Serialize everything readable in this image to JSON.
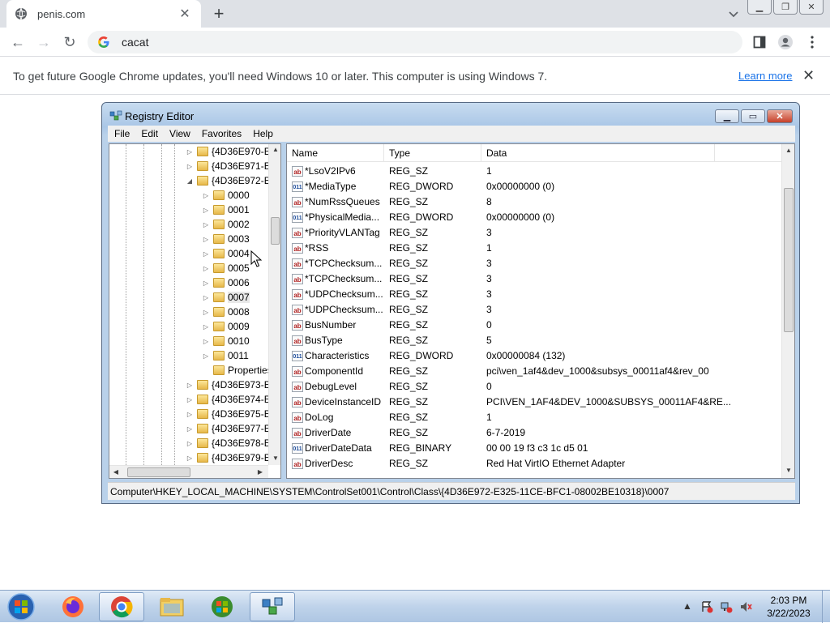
{
  "browser": {
    "tab_title": "penis.com",
    "tab_close": "✕",
    "new_tab": "+",
    "omnibox_text": "cacat",
    "infobar_text": "To get future Google Chrome updates, you'll need Windows 10 or later. This computer is using Windows 7.",
    "infobar_link": "Learn more",
    "infobar_close": "✕"
  },
  "regedit": {
    "title": "Registry Editor",
    "menu": [
      "File",
      "Edit",
      "View",
      "Favorites",
      "Help"
    ],
    "tree": [
      {
        "label": "{4D36E970-E",
        "expander": "▷",
        "indent": 0
      },
      {
        "label": "{4D36E971-E",
        "expander": "▷",
        "indent": 0
      },
      {
        "label": "{4D36E972-E",
        "expander": "◢",
        "indent": 0
      },
      {
        "label": "0000",
        "expander": "▷",
        "indent": 1
      },
      {
        "label": "0001",
        "expander": "▷",
        "indent": 1
      },
      {
        "label": "0002",
        "expander": "▷",
        "indent": 1
      },
      {
        "label": "0003",
        "expander": "▷",
        "indent": 1
      },
      {
        "label": "0004",
        "expander": "▷",
        "indent": 1
      },
      {
        "label": "0005",
        "expander": "▷",
        "indent": 1
      },
      {
        "label": "0006",
        "expander": "▷",
        "indent": 1
      },
      {
        "label": "0007",
        "expander": "▷",
        "indent": 1,
        "selected": true
      },
      {
        "label": "0008",
        "expander": "▷",
        "indent": 1
      },
      {
        "label": "0009",
        "expander": "▷",
        "indent": 1
      },
      {
        "label": "0010",
        "expander": "▷",
        "indent": 1
      },
      {
        "label": "0011",
        "expander": "▷",
        "indent": 1
      },
      {
        "label": "Properties",
        "expander": "",
        "indent": 1
      },
      {
        "label": "{4D36E973-E",
        "expander": "▷",
        "indent": 0
      },
      {
        "label": "{4D36E974-E",
        "expander": "▷",
        "indent": 0
      },
      {
        "label": "{4D36E975-E",
        "expander": "▷",
        "indent": 0
      },
      {
        "label": "{4D36E977-E",
        "expander": "▷",
        "indent": 0
      },
      {
        "label": "{4D36E978-E",
        "expander": "▷",
        "indent": 0
      },
      {
        "label": "{4D36E979-E",
        "expander": "▷",
        "indent": 0
      }
    ],
    "columns": {
      "name": "Name",
      "type": "Type",
      "data": "Data"
    },
    "values": [
      {
        "icon": "ab",
        "name": "*LsoV2IPv6",
        "type": "REG_SZ",
        "data": "1"
      },
      {
        "icon": "bin",
        "name": "*MediaType",
        "type": "REG_DWORD",
        "data": "0x00000000 (0)"
      },
      {
        "icon": "ab",
        "name": "*NumRssQueues",
        "type": "REG_SZ",
        "data": "8"
      },
      {
        "icon": "bin",
        "name": "*PhysicalMedia...",
        "type": "REG_DWORD",
        "data": "0x00000000 (0)"
      },
      {
        "icon": "ab",
        "name": "*PriorityVLANTag",
        "type": "REG_SZ",
        "data": "3"
      },
      {
        "icon": "ab",
        "name": "*RSS",
        "type": "REG_SZ",
        "data": "1"
      },
      {
        "icon": "ab",
        "name": "*TCPChecksum...",
        "type": "REG_SZ",
        "data": "3"
      },
      {
        "icon": "ab",
        "name": "*TCPChecksum...",
        "type": "REG_SZ",
        "data": "3"
      },
      {
        "icon": "ab",
        "name": "*UDPChecksum...",
        "type": "REG_SZ",
        "data": "3"
      },
      {
        "icon": "ab",
        "name": "*UDPChecksum...",
        "type": "REG_SZ",
        "data": "3"
      },
      {
        "icon": "ab",
        "name": "BusNumber",
        "type": "REG_SZ",
        "data": "0"
      },
      {
        "icon": "ab",
        "name": "BusType",
        "type": "REG_SZ",
        "data": "5"
      },
      {
        "icon": "bin",
        "name": "Characteristics",
        "type": "REG_DWORD",
        "data": "0x00000084 (132)"
      },
      {
        "icon": "ab",
        "name": "ComponentId",
        "type": "REG_SZ",
        "data": "pci\\ven_1af4&dev_1000&subsys_00011af4&rev_00"
      },
      {
        "icon": "ab",
        "name": "DebugLevel",
        "type": "REG_SZ",
        "data": "0"
      },
      {
        "icon": "ab",
        "name": "DeviceInstanceID",
        "type": "REG_SZ",
        "data": "PCI\\VEN_1AF4&DEV_1000&SUBSYS_00011AF4&RE..."
      },
      {
        "icon": "ab",
        "name": "DoLog",
        "type": "REG_SZ",
        "data": "1"
      },
      {
        "icon": "ab",
        "name": "DriverDate",
        "type": "REG_SZ",
        "data": "6-7-2019"
      },
      {
        "icon": "bin",
        "name": "DriverDateData",
        "type": "REG_BINARY",
        "data": "00 00 19 f3 c3 1c d5 01"
      },
      {
        "icon": "ab",
        "name": "DriverDesc",
        "type": "REG_SZ",
        "data": "Red Hat VirtIO Ethernet Adapter"
      }
    ],
    "status_path": "Computer\\HKEY_LOCAL_MACHINE\\SYSTEM\\ControlSet001\\Control\\Class\\{4D36E972-E325-11CE-BFC1-08002BE10318}\\0007"
  },
  "taskbar": {
    "time": "2:03 PM",
    "date": "3/22/2023"
  },
  "colors": {
    "accent": "#1a73e8",
    "taskbar": "#bfd3ea"
  }
}
